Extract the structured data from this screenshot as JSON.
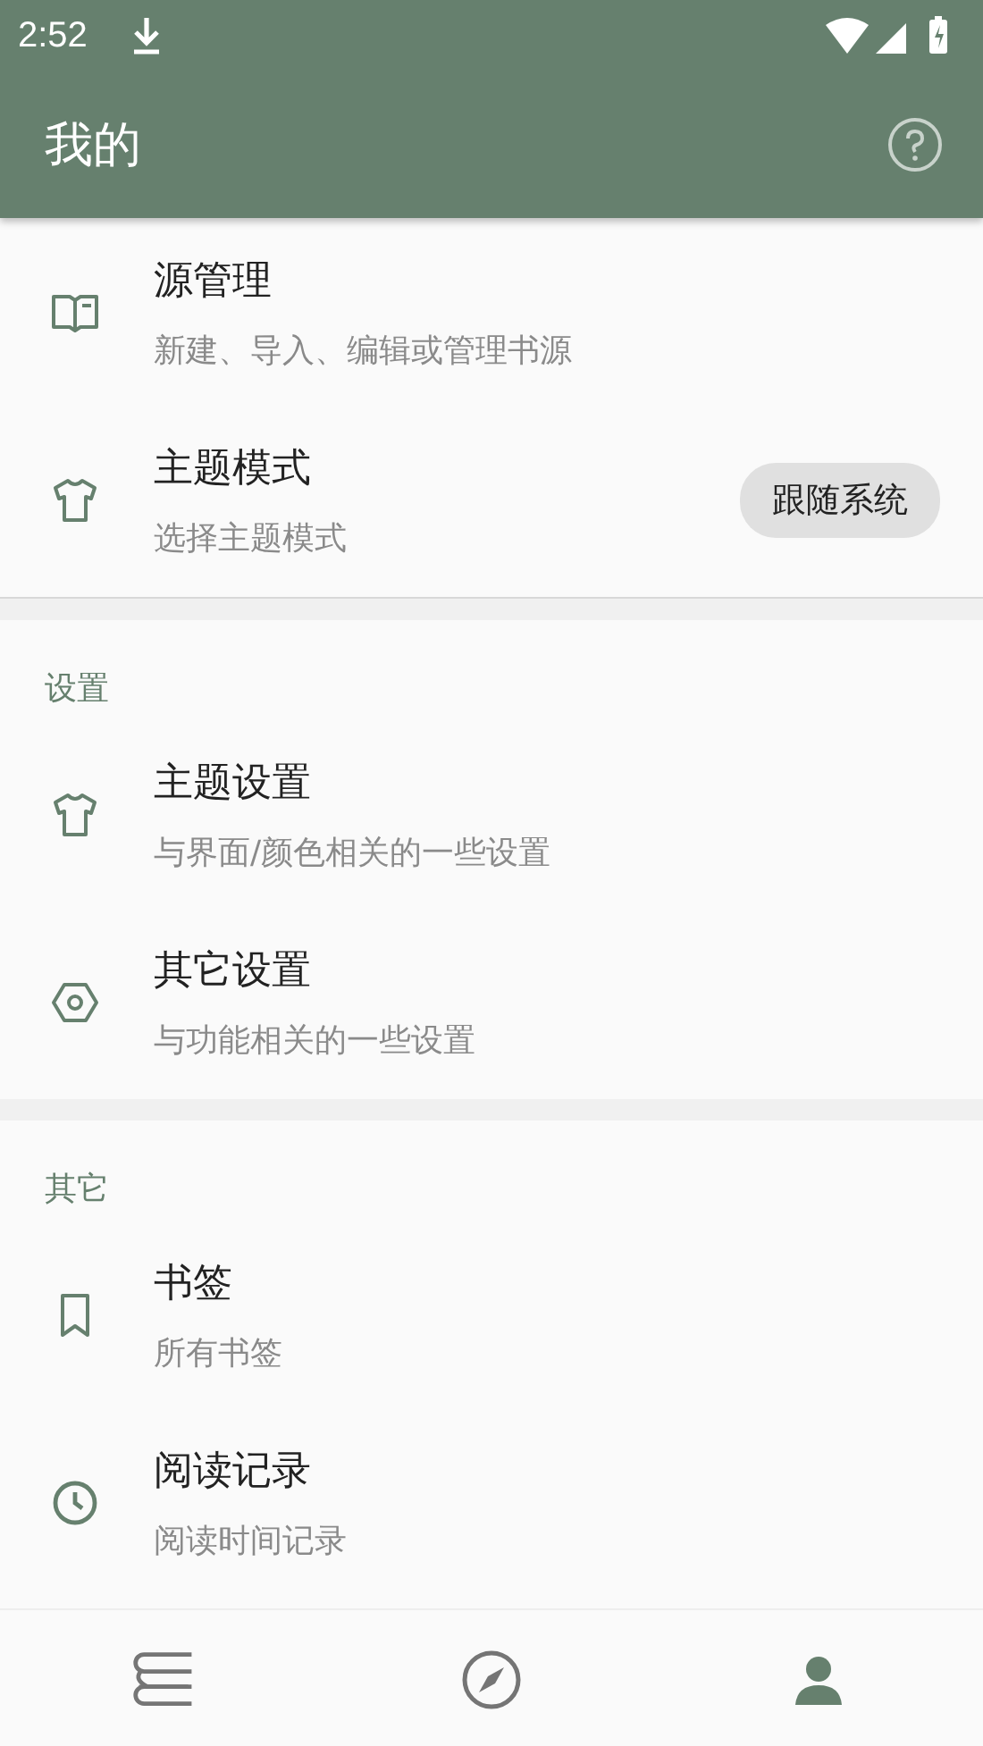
{
  "status_bar": {
    "time": "2:52"
  },
  "toolbar": {
    "title": "我的"
  },
  "sections": [
    {
      "items": [
        {
          "kind": "book",
          "title": "源管理",
          "subtitle": "新建、导入、编辑或管理书源"
        },
        {
          "kind": "shirt",
          "title": "主题模式",
          "subtitle": "选择主题模式",
          "chip": "跟随系统"
        }
      ]
    },
    {
      "header": "设置",
      "items": [
        {
          "kind": "shirt",
          "title": "主题设置",
          "subtitle": "与界面/颜色相关的一些设置"
        },
        {
          "kind": "hexagon",
          "title": "其它设置",
          "subtitle": "与功能相关的一些设置"
        }
      ]
    },
    {
      "header": "其它",
      "items": [
        {
          "kind": "bookmark",
          "title": "书签",
          "subtitle": "所有书签"
        },
        {
          "kind": "clock",
          "title": "阅读记录",
          "subtitle": "阅读时间记录"
        }
      ]
    }
  ],
  "bottom_nav": [
    {
      "kind": "books",
      "selected": false
    },
    {
      "kind": "compass",
      "selected": false
    },
    {
      "kind": "person",
      "selected": true
    }
  ]
}
